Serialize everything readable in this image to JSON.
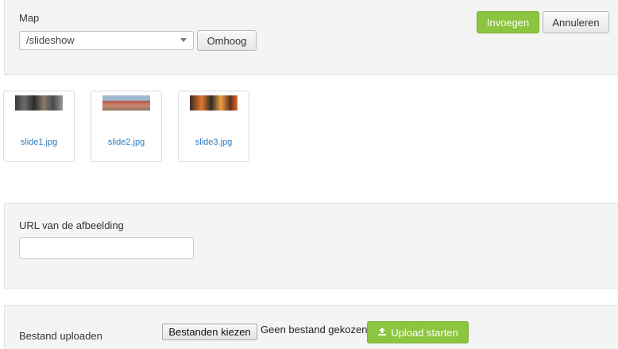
{
  "folder": {
    "label": "Map",
    "selected": "/slideshow",
    "up_button": "Omhoog"
  },
  "actions": {
    "insert": "Invoegen",
    "cancel": "Annuleren"
  },
  "files": [
    {
      "name": "slide1.jpg"
    },
    {
      "name": "slide2.jpg"
    },
    {
      "name": "slide3.jpg"
    }
  ],
  "url_field": {
    "label": "URL van de afbeelding",
    "value": ""
  },
  "upload": {
    "label": "Bestand uploaden",
    "choose_button": "Bestanden kiezen",
    "status": "Geen bestand gekozen",
    "start_button": "Upload starten",
    "start_icon": "upload-icon"
  },
  "colors": {
    "primary_button": "#8cc53f",
    "link": "#2d7cc1",
    "panel_background": "#f4f4f4"
  }
}
